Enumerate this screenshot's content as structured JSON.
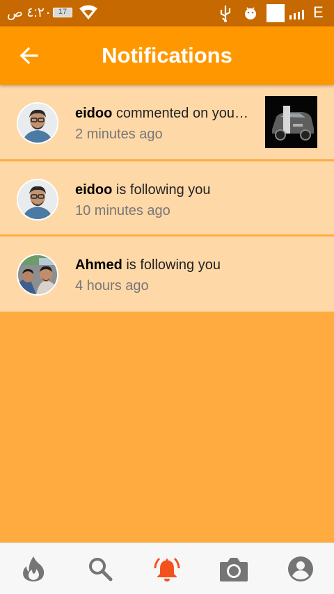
{
  "status_bar": {
    "time": "٤:٢٠ ص",
    "battery": "17",
    "network": "E",
    "icons": [
      "wifi-icon",
      "usb-icon",
      "android-icon",
      "signal-icon"
    ]
  },
  "app_bar": {
    "title": "Notifications",
    "back_icon": "arrow-left-icon"
  },
  "notifications": [
    {
      "user": "eidoo",
      "action": " commented on your post",
      "time": "2 minutes ago",
      "has_thumbnail": true
    },
    {
      "user": "eidoo",
      "action": " is following you",
      "time": "10 minutes ago",
      "has_thumbnail": false
    },
    {
      "user": "Ahmed",
      "action": " is following you",
      "time": "4 hours ago",
      "has_thumbnail": false
    }
  ],
  "bottom_nav": {
    "items": [
      {
        "name": "flame-icon",
        "active": false
      },
      {
        "name": "search-icon",
        "active": false
      },
      {
        "name": "bell-icon",
        "active": true
      },
      {
        "name": "camera-icon",
        "active": false
      },
      {
        "name": "profile-icon",
        "active": false
      }
    ],
    "active_color": "#f4511e",
    "inactive_color": "#757575"
  },
  "colors": {
    "status_bar": "#c66900",
    "app_bar": "#ff9800",
    "background": "#ffab40",
    "item_background": "#ffd8a8"
  }
}
